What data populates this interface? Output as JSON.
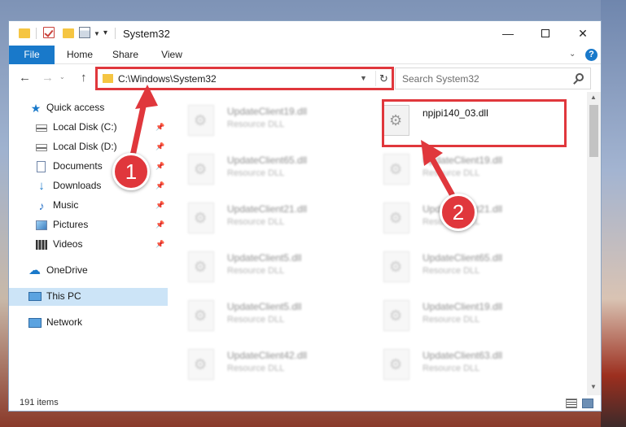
{
  "titlebar": {
    "title": "System32",
    "minimize_glyph": "—",
    "close_glyph": "✕"
  },
  "ribbon": {
    "tabs": [
      {
        "label": "File"
      },
      {
        "label": "Home"
      },
      {
        "label": "Share"
      },
      {
        "label": "View"
      }
    ],
    "help_glyph": "?"
  },
  "navigation": {
    "back_glyph": "←",
    "forward_glyph": "→",
    "up_glyph": "↑",
    "address": "C:\\Windows\\System32",
    "refresh_glyph": "↻",
    "search_placeholder": "Search System32"
  },
  "sidebar": {
    "items": [
      {
        "label": "Quick access",
        "icon": "star-icon"
      },
      {
        "label": "Local Disk (C:)",
        "icon": "drive-icon",
        "pinned": true
      },
      {
        "label": "Local Disk (D:)",
        "icon": "drive-icon",
        "pinned": true
      },
      {
        "label": "Documents",
        "icon": "documents-icon",
        "pinned": true
      },
      {
        "label": "Downloads",
        "icon": "download-icon",
        "pinned": true
      },
      {
        "label": "Music",
        "icon": "music-icon",
        "pinned": true
      },
      {
        "label": "Pictures",
        "icon": "pictures-icon",
        "pinned": true
      },
      {
        "label": "Videos",
        "icon": "videos-icon",
        "pinned": true
      },
      {
        "label": "OneDrive",
        "icon": "cloud-icon"
      },
      {
        "label": "This PC",
        "icon": "pc-icon",
        "selected": true
      },
      {
        "label": "Network",
        "icon": "network-icon"
      }
    ]
  },
  "files": {
    "left_column": [
      {
        "name": "UpdateClient19.dll",
        "type": "Resource DLL"
      },
      {
        "name": "UpdateClient65.dll",
        "type": "Resource DLL"
      },
      {
        "name": "UpdateClient21.dll",
        "type": "Resource DLL"
      },
      {
        "name": "UpdateClient5.dll",
        "type": "Resource DLL"
      },
      {
        "name": "UpdateClient5.dll",
        "type": "Resource DLL"
      },
      {
        "name": "UpdateClient42.dll",
        "type": "Resource DLL"
      }
    ],
    "right_column": [
      {
        "name": "npjpi140_03.dll",
        "type": ""
      },
      {
        "name": "UpdateClient19.dll",
        "type": "Resource DLL"
      },
      {
        "name": "UpdateClient21.dll",
        "type": "Resource DLL"
      },
      {
        "name": "UpdateClient65.dll",
        "type": "Resource DLL"
      },
      {
        "name": "UpdateClient19.dll",
        "type": "Resource DLL"
      },
      {
        "name": "UpdateClient63.dll",
        "type": "Resource DLL"
      }
    ]
  },
  "status": {
    "item_count": "191 items"
  },
  "annotations": {
    "step_1": "1",
    "step_2": "2",
    "color": "#e0373c"
  }
}
